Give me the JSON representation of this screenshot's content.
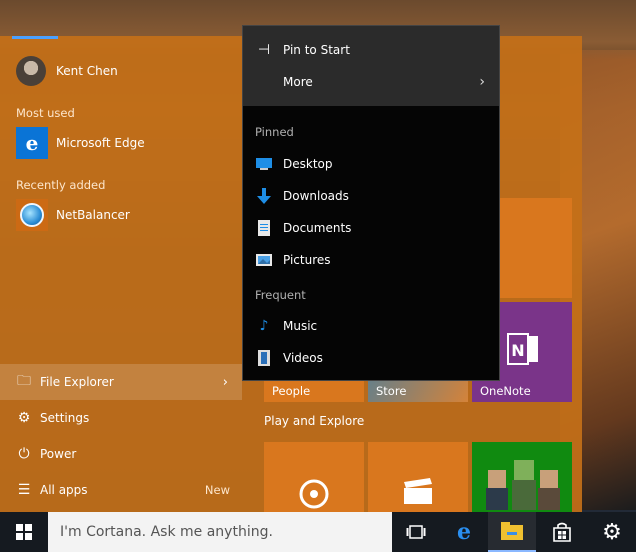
{
  "user": {
    "name": "Kent Chen"
  },
  "sections": {
    "most_used": "Most used",
    "recently_added": "Recently added"
  },
  "apps": {
    "edge": "Microsoft Edge",
    "netbalancer": "NetBalancer"
  },
  "bottom": {
    "file_explorer": "File Explorer",
    "settings": "Settings",
    "power": "Power",
    "all_apps": "All apps",
    "new_badge": "New"
  },
  "context_menu": {
    "pin_to_start": "Pin to Start",
    "more": "More",
    "pinned_label": "Pinned",
    "pinned": [
      "Desktop",
      "Downloads",
      "Documents",
      "Pictures"
    ],
    "frequent_label": "Frequent",
    "frequent": [
      "Music",
      "Videos"
    ]
  },
  "tiles": {
    "people": "People",
    "store": "Store",
    "onenote": "OneNote",
    "play_and_explore": "Play and Explore"
  },
  "taskbar": {
    "cortana_placeholder": "I'm Cortana. Ask me anything."
  },
  "colors": {
    "accent": "#c47018",
    "onenote": "#7a3489",
    "edge": "#0a74d6",
    "xbox": "#108a10"
  }
}
